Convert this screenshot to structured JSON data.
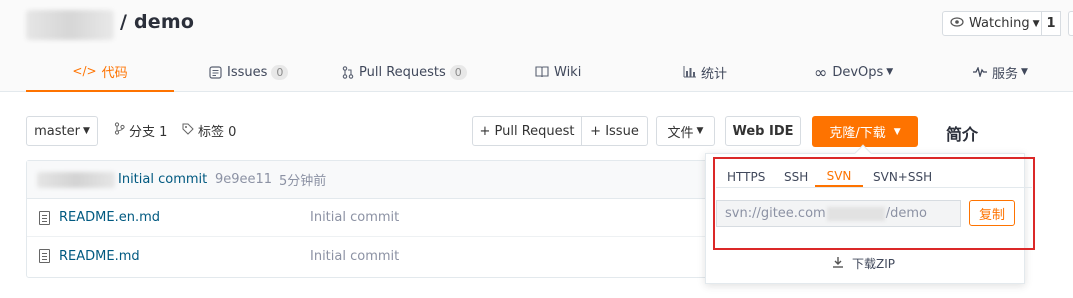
{
  "repo": {
    "name": "/ demo"
  },
  "watch": {
    "label": "Watching",
    "count": "1"
  },
  "tabs": [
    {
      "label": "代码",
      "icon": "code-icon"
    },
    {
      "label": "Issues",
      "badge": "0",
      "icon": "issues-icon"
    },
    {
      "label": "Pull Requests",
      "badge": "0",
      "icon": "pull-request-icon"
    },
    {
      "label": "Wiki",
      "icon": "wiki-icon"
    },
    {
      "label": "统计",
      "icon": "chart-icon"
    },
    {
      "label": "DevOps",
      "icon": "infinity-icon"
    },
    {
      "label": "服务",
      "icon": "pulse-icon"
    }
  ],
  "toolbar": {
    "branch": "master",
    "branches_label": "分支 1",
    "tags_label": "标签 0",
    "pull_request_btn": "+ Pull Request",
    "issue_btn": "+ Issue",
    "file_btn": "文件",
    "webide_btn": "Web IDE",
    "clone_btn": "克隆/下载",
    "intro": "简介"
  },
  "commit": {
    "message": "Initial commit",
    "hash": "9e9ee11",
    "time": "5分钟前"
  },
  "files": [
    {
      "name": "README.en.md",
      "message": "Initial commit"
    },
    {
      "name": "README.md",
      "message": "Initial commit"
    }
  ],
  "clone_panel": {
    "protocols": [
      "HTTPS",
      "SSH",
      "SVN",
      "SVN+SSH"
    ],
    "active": "SVN",
    "url_prefix": "svn://gitee.com",
    "url_suffix": "/demo",
    "copy_label": "复制",
    "zip_label": "下载ZIP"
  },
  "colors": {
    "accent": "#fe7300",
    "highlight": "#db2828",
    "link": "#005980"
  }
}
